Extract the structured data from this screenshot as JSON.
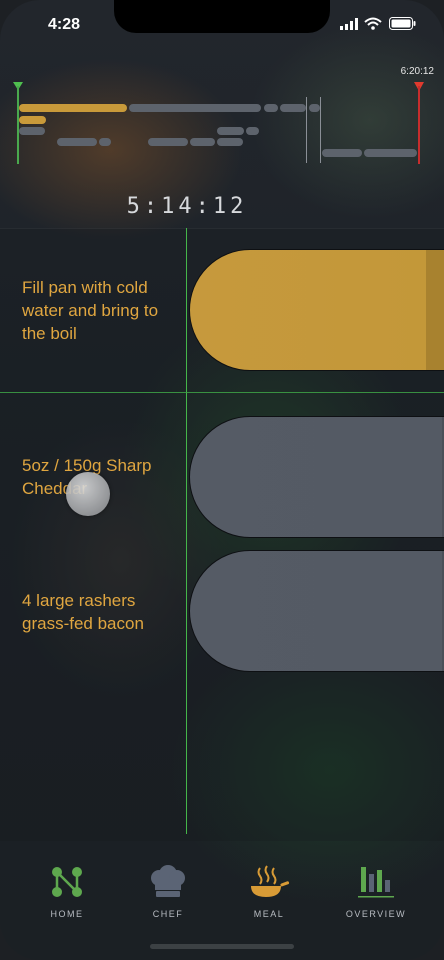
{
  "status_bar": {
    "time": "4:28",
    "icons": [
      "signal-icon",
      "wifi-icon",
      "battery-icon"
    ]
  },
  "timeline": {
    "end_time": "6:20:12",
    "elapsed_clock": "5:14:12"
  },
  "steps": [
    {
      "label": "Fill pan with cold water and bring to the boil",
      "state": "active",
      "color": "#c6993d"
    },
    {
      "label": "5oz / 150g Sharp Cheddar",
      "state": "pending",
      "color": "#555b65"
    },
    {
      "label": "4 large rashers grass-fed bacon",
      "state": "pending",
      "color": "#555b65"
    }
  ],
  "tabbar": {
    "tabs": [
      {
        "label": "HOME",
        "icon": "network-icon",
        "color": "#5ea84e"
      },
      {
        "label": "CHEF",
        "icon": "chef-hat-icon",
        "color": "#5b6475"
      },
      {
        "label": "MEAL",
        "icon": "frying-pan-icon",
        "color": "#d89b36"
      },
      {
        "label": "OVERVIEW",
        "icon": "bar-chart-icon",
        "color": "#5ea84e"
      }
    ]
  },
  "colors": {
    "accent_gold": "#c6993d",
    "guide_green": "#45b64a",
    "end_red": "#c82d2d",
    "label_orange": "#e0a640"
  }
}
